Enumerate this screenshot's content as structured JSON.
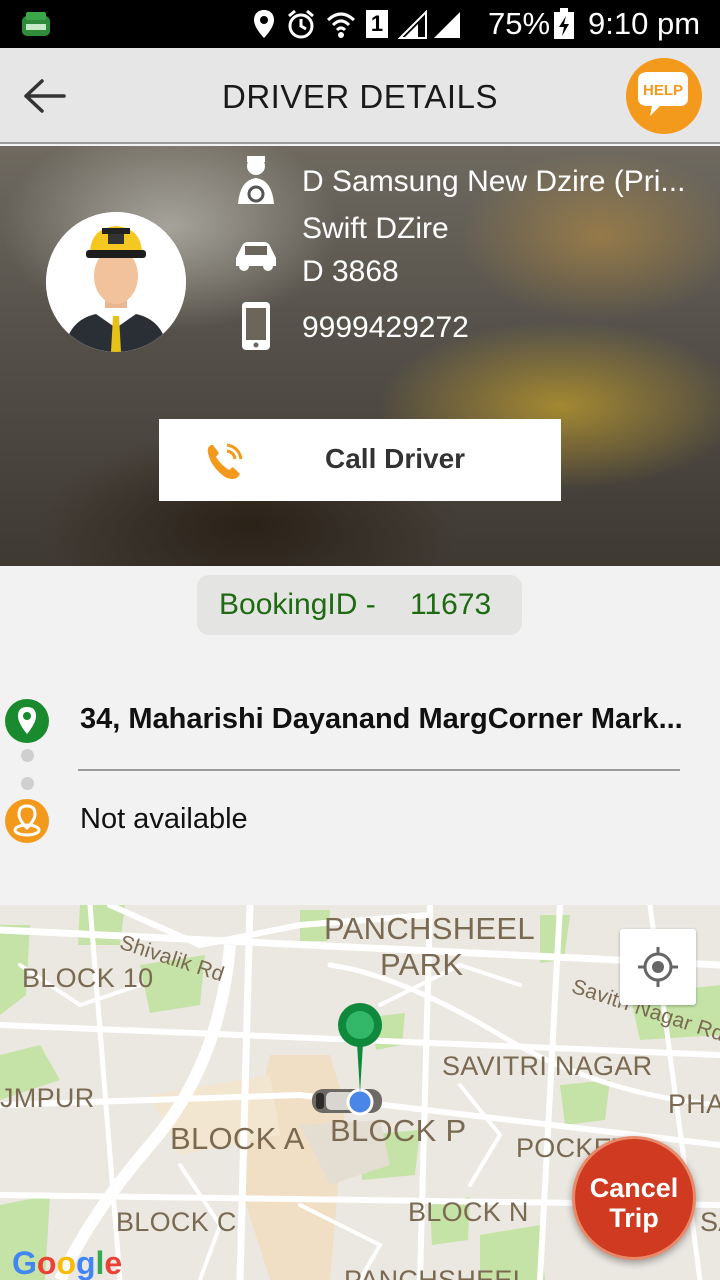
{
  "status_bar": {
    "battery": "75%",
    "time": "9:10 pm",
    "sim_slot": "1",
    "icons": [
      "app-icon",
      "location-icon",
      "alarm-icon",
      "wifi-icon",
      "sim-icon",
      "signal-icon",
      "battery-icon"
    ]
  },
  "app_bar": {
    "title": "DRIVER DETAILS",
    "help_label": "HELP",
    "back_icon": "arrow-left-icon"
  },
  "driver": {
    "name": "D Samsung New Dzire (Pri...",
    "car_model": "Swift DZire",
    "car_number": "D 3868",
    "phone": "9999429272",
    "call_label": "Call Driver"
  },
  "booking": {
    "label": "BookingID -",
    "id": "11673"
  },
  "trip": {
    "pickup": "34, Maharishi Dayanand MargCorner Mark...",
    "drop": "Not available"
  },
  "map": {
    "labels": {
      "panchsheel_park": "PANCHSHEEL",
      "panchsheel_park2": "PARK",
      "shivalik": "Shivalik Rd",
      "block10": "BLOCK 10",
      "savitri_rd": "Savitri Nagar Rd",
      "savitri_nagar": "SAVITRI NAGAR",
      "jumpur": "JMPUR",
      "pha": "PHA",
      "block_a": "BLOCK A",
      "block_p": "BLOCK P",
      "pocket": "POCKET",
      "block_c": "BLOCK C",
      "block_n": "BLOCK N",
      "panchsheel_bottom": "PANCHSHEEL",
      "sa": "SA"
    },
    "google": "Google"
  },
  "cancel": {
    "line1": "Cancel",
    "line2": "Trip"
  },
  "colors": {
    "accent_orange": "#f39a1d",
    "booking_green": "#1e6a12",
    "cancel_red": "#d03a20",
    "pin_green": "#0f8a3c"
  }
}
